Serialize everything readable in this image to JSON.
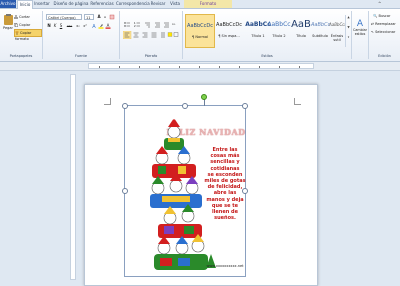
{
  "tabs": {
    "file": "Archivo",
    "home": "Inicio",
    "insert": "Insertar",
    "page_layout": "Diseño de página",
    "references": "Referencias",
    "mailings": "Correspondencia",
    "review": "Revisar",
    "view": "Vista",
    "format": "Formato"
  },
  "clipboard": {
    "paste": "Pegar",
    "cut": "Cortar",
    "copy": "Copiar",
    "format_painter": "Copiar formato",
    "group_label": "Portapapeles"
  },
  "font": {
    "name": "Calibri (Cuerpo)",
    "size": "11",
    "group_label": "Fuente",
    "buttons": [
      "N",
      "K",
      "S",
      "abc",
      "x₂",
      "x²",
      "A",
      "A"
    ]
  },
  "paragraph": {
    "group_label": "Párrafo"
  },
  "styles": {
    "group_label": "Estilos",
    "items": [
      {
        "preview": "AaBbCcDc",
        "name": "¶ Normal"
      },
      {
        "preview": "AaBbCcDc",
        "name": "¶ Sin espa..."
      },
      {
        "preview": "AaBbCc",
        "name": "Título 1"
      },
      {
        "preview": "AaBbCc",
        "name": "Título 2"
      },
      {
        "preview": "AaB",
        "name": "Título"
      },
      {
        "preview": "AaBbCc.",
        "name": "Subtítulo"
      },
      {
        "preview": "AaBbCcDc",
        "name": "Énfasis sutil"
      }
    ]
  },
  "change_styles": {
    "label": "Cambiar estilos"
  },
  "editing": {
    "group_label": "Edición",
    "find": "Buscar",
    "replace": "Reemplazar",
    "select": "Seleccionar"
  },
  "card": {
    "title": "FELIZ NAVIDAD",
    "message": "Entre las\ncosas más\nsencillas y\ncotidianas\nse esconden\nmiles de gotas\nde felicidad,\nabre las\nmanos y deja\nque se te\nllenen de\nsueños.",
    "url": "www.xxxxxxxxxx.net"
  },
  "colors": {
    "file_tab": "#2a5bb0",
    "card_text": "#c41818",
    "title_fill": "#e9b3b3"
  }
}
